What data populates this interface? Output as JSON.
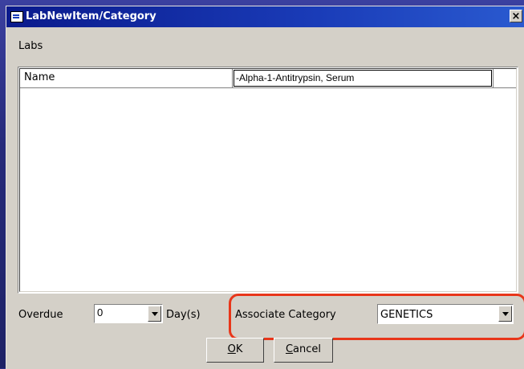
{
  "window": {
    "title": "LabNewItem/Category",
    "close_glyph": "×"
  },
  "labs_label": "Labs",
  "grid": {
    "header_label": "Name",
    "name_value": "-Alpha-1-Antitrypsin, Serum"
  },
  "overdue": {
    "label": "Overdue",
    "value": "0",
    "unit_label": "Day(s)"
  },
  "associate": {
    "label": "Associate Category",
    "value": "GENETICS"
  },
  "buttons": {
    "ok_label": "OK",
    "ok_mnemonic": "O",
    "ok_rest": "K",
    "cancel_label": "Cancel",
    "cancel_mnemonic": "C",
    "cancel_rest": "ancel"
  },
  "colors": {
    "titlebar": "#0a1a8c",
    "dialog_bg": "#d4d0c8",
    "highlight": "#e8361a",
    "desktop": "#2b2f86"
  },
  "icons": [
    "app-window-icon",
    "close-icon",
    "dropdown-arrow-icon"
  ]
}
